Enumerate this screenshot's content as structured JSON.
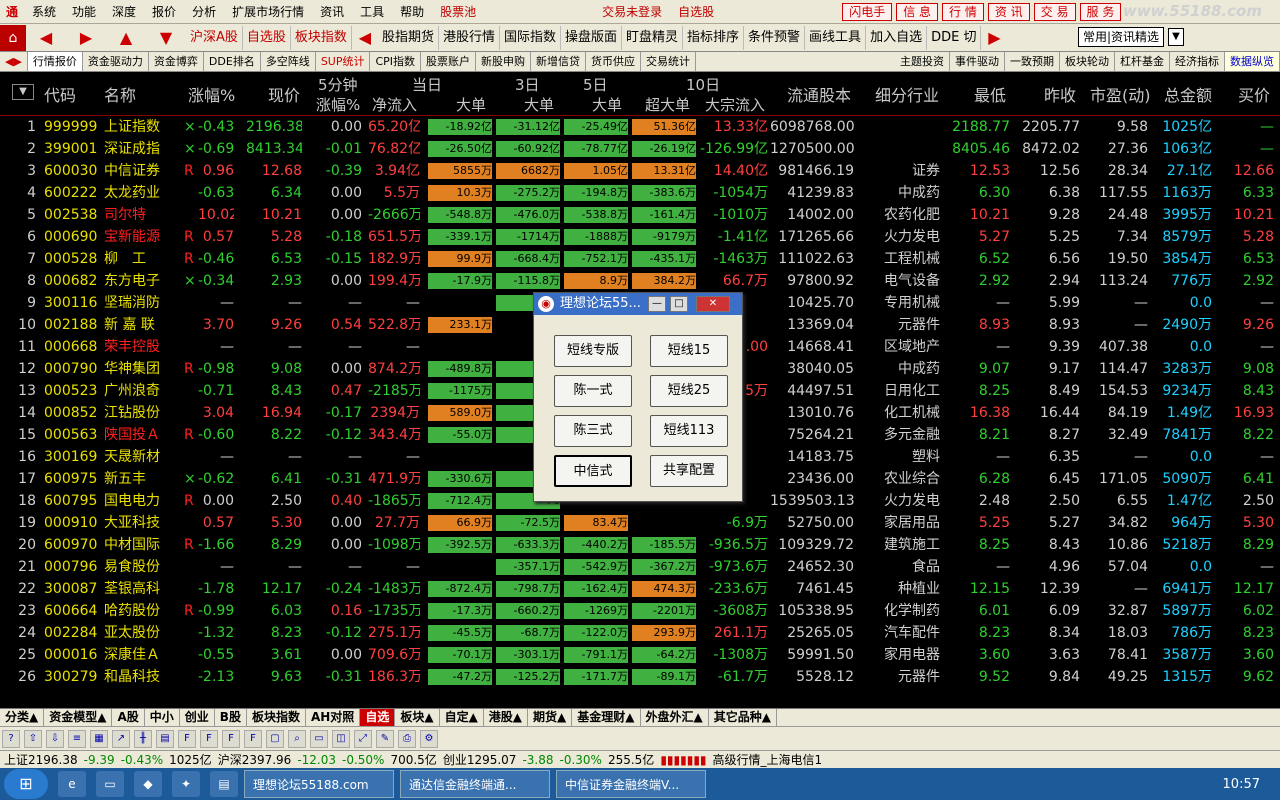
{
  "menu": {
    "items": [
      "系统",
      "功能",
      "深度",
      "报价",
      "分析",
      "扩展市场行情",
      "资讯",
      "工具",
      "帮助"
    ],
    "stockpool": "股票池",
    "login_status": "交易未登录",
    "favorites": "自选股",
    "flash": "闪电手",
    "right": [
      "信 息",
      "行 情",
      "资 讯",
      "交 易",
      "服 务"
    ],
    "watermark": "www.55188.com"
  },
  "toolbar": {
    "items": [
      "沪深A股",
      "自选股",
      "板块指数",
      "股指期货",
      "港股行情",
      "国际指数",
      "操盘版面",
      "盯盘精灵",
      "指标排序",
      "条件预警",
      "画线工具",
      "加入自选",
      "DDE 切"
    ],
    "dropdown": "常用|资讯精选"
  },
  "tabs": {
    "left": [
      "行情报价",
      "资金驱动力",
      "资金博弈",
      "DDE排名",
      "多空阵线",
      "SUP统计",
      "CPI指数",
      "股票账户",
      "新股申购",
      "新增信贷",
      "货币供应",
      "交易统计"
    ],
    "right": [
      "主题投资",
      "事件驱动",
      "一致预期",
      "板块轮动",
      "杠杆基金",
      "经济指标",
      "数据纵览"
    ]
  },
  "header": {
    "group5": "5分钟",
    "groupToday": "当日",
    "group3": "3日",
    "group5d": "5日",
    "group10": "10日",
    "cols": [
      "代码",
      "名称",
      "涨幅%",
      "现价",
      "涨幅%",
      "净流入",
      "大单",
      "大单",
      "大单",
      "超大单",
      "大宗流入",
      "流通股本",
      "细分行业",
      "最低",
      "昨收",
      "市盈(动)",
      "总金额",
      "买价"
    ]
  },
  "rows": [
    {
      "n": "1",
      "code": "999999",
      "name": "上证指数",
      "flag": "×",
      "chg": "-0.43",
      "price": "2196.38",
      "m5": "0.00",
      "net": "65.20亿",
      "b1": "-18.92亿",
      "b3": "-31.12亿",
      "b5": "-25.49亿",
      "b10": "51.36亿",
      "bulk": "13.33亿",
      "cap": "6098768.00",
      "ind": "",
      "low": "2188.77",
      "prev": "2205.77",
      "pe": "9.58",
      "amt": "1025亿",
      "bid": "—"
    },
    {
      "n": "2",
      "code": "399001",
      "name": "深证成指",
      "flag": "×",
      "chg": "-0.69",
      "price": "8413.34",
      "m5": "-0.01",
      "net": "76.82亿",
      "b1": "-26.50亿",
      "b3": "-60.92亿",
      "b5": "-78.77亿",
      "b10": "-26.19亿",
      "bulk": "-126.99亿",
      "cap": "1270500.00",
      "ind": "",
      "low": "8405.46",
      "prev": "8472.02",
      "pe": "27.36",
      "amt": "1063亿",
      "bid": "—"
    },
    {
      "n": "3",
      "code": "600030",
      "name": "中信证券",
      "flag": "R",
      "chg": "0.96",
      "price": "12.68",
      "m5": "-0.39",
      "net": "3.94亿",
      "b1": "5855万",
      "b3": "6682万",
      "b5": "1.05亿",
      "b10": "13.31亿",
      "bulk": "14.40亿",
      "cap": "981466.19",
      "ind": "证券",
      "low": "12.53",
      "prev": "12.56",
      "pe": "28.34",
      "amt": "27.1亿",
      "bid": "12.66"
    },
    {
      "n": "4",
      "code": "600222",
      "name": "太龙药业",
      "flag": "",
      "chg": "-0.63",
      "price": "6.34",
      "m5": "0.00",
      "net": "5.5万",
      "b1": "10.3万",
      "b3": "-275.2万",
      "b5": "-194.8万",
      "b10": "-383.6万",
      "bulk": "-1054万",
      "cap": "41239.83",
      "ind": "中成药",
      "low": "6.30",
      "prev": "6.38",
      "pe": "117.55",
      "amt": "1163万",
      "bid": "6.33"
    },
    {
      "n": "5",
      "code": "002538",
      "name": "司尔特",
      "flag": "",
      "chg": "10.02",
      "price": "10.21",
      "m5": "0.00",
      "net": "-2666万",
      "b1": "-548.8万",
      "b3": "-476.0万",
      "b5": "-538.8万",
      "b10": "-161.4万",
      "bulk": "-1010万",
      "cap": "14002.00",
      "ind": "农药化肥",
      "low": "10.21",
      "prev": "9.28",
      "pe": "24.48",
      "amt": "3995万",
      "bid": "10.21"
    },
    {
      "n": "6",
      "code": "000690",
      "name": "宝新能源",
      "flag": "R",
      "chg": "0.57",
      "price": "5.28",
      "m5": "-0.18",
      "net": "651.5万",
      "b1": "-339.1万",
      "b3": "-1714万",
      "b5": "-1888万",
      "b10": "-9179万",
      "bulk": "-1.41亿",
      "cap": "171265.66",
      "ind": "火力发电",
      "low": "5.27",
      "prev": "5.25",
      "pe": "7.34",
      "amt": "8579万",
      "bid": "5.28"
    },
    {
      "n": "7",
      "code": "000528",
      "name": "柳　工",
      "flag": "R",
      "chg": "-0.46",
      "price": "6.53",
      "m5": "-0.15",
      "net": "182.9万",
      "b1": "99.9万",
      "b3": "-668.4万",
      "b5": "-752.1万",
      "b10": "-435.1万",
      "bulk": "-1463万",
      "cap": "111022.63",
      "ind": "工程机械",
      "low": "6.52",
      "prev": "6.56",
      "pe": "19.50",
      "amt": "3854万",
      "bid": "6.53"
    },
    {
      "n": "8",
      "code": "000682",
      "name": "东方电子",
      "flag": "×",
      "chg": "-0.34",
      "price": "2.93",
      "m5": "0.00",
      "net": "199.4万",
      "b1": "-17.9万",
      "b3": "-115.8万",
      "b5": "8.9万",
      "b10": "384.2万",
      "bulk": "66.7万",
      "cap": "97800.92",
      "ind": "电气设备",
      "low": "2.92",
      "prev": "2.94",
      "pe": "113.24",
      "amt": "776万",
      "bid": "2.92"
    },
    {
      "n": "9",
      "code": "300116",
      "name": "坚瑞消防",
      "flag": "",
      "chg": "—",
      "price": "—",
      "m5": "—",
      "net": "—",
      "b1": "",
      "b3": "-22",
      "b5": "",
      "b10": "",
      "bulk": "",
      "cap": "10425.70",
      "ind": "专用机械",
      "low": "—",
      "prev": "5.99",
      "pe": "—",
      "amt": "0.0",
      "bid": "—"
    },
    {
      "n": "10",
      "code": "002188",
      "name": "新 嘉 联",
      "flag": "",
      "chg": "3.70",
      "price": "9.26",
      "m5": "0.54",
      "net": "522.8万",
      "b1": "233.1万",
      "b3": "",
      "b5": "",
      "b10": "",
      "bulk": "",
      "cap": "13369.04",
      "ind": "元器件",
      "low": "8.93",
      "prev": "8.93",
      "pe": "—",
      "amt": "2490万",
      "bid": "9.26"
    },
    {
      "n": "11",
      "code": "000668",
      "name": "荣丰控股",
      "flag": "",
      "chg": "—",
      "price": "—",
      "m5": "—",
      "net": "—",
      "b1": "",
      "b3": "",
      "b5": "",
      "b10": "",
      "bulk": ".00",
      "cap": "14668.41",
      "ind": "区域地产",
      "low": "—",
      "prev": "9.39",
      "pe": "407.38",
      "amt": "0.0",
      "bid": "—"
    },
    {
      "n": "12",
      "code": "000790",
      "name": "华神集团",
      "flag": "R",
      "chg": "-0.98",
      "price": "9.08",
      "m5": "0.00",
      "net": "874.2万",
      "b1": "-489.8万",
      "b3": "-1",
      "b5": "",
      "b10": "",
      "bulk": "",
      "cap": "38040.05",
      "ind": "中成药",
      "low": "9.07",
      "prev": "9.17",
      "pe": "114.47",
      "amt": "3283万",
      "bid": "9.08"
    },
    {
      "n": "13",
      "code": "000523",
      "name": "广州浪奇",
      "flag": "",
      "chg": "-0.71",
      "price": "8.43",
      "m5": "0.47",
      "net": "-2185万",
      "b1": "-1175万",
      "b3": "-1",
      "b5": "",
      "b10": "",
      "bulk": "5万",
      "cap": "44497.51",
      "ind": "日用化工",
      "low": "8.25",
      "prev": "8.49",
      "pe": "154.53",
      "amt": "9234万",
      "bid": "8.43"
    },
    {
      "n": "14",
      "code": "000852",
      "name": "江钻股份",
      "flag": "",
      "chg": "3.04",
      "price": "16.94",
      "m5": "-0.17",
      "net": "2394万",
      "b1": "589.0万",
      "b3": "-5",
      "b5": "",
      "b10": "",
      "bulk": "",
      "cap": "13010.76",
      "ind": "化工机械",
      "low": "16.38",
      "prev": "16.44",
      "pe": "84.19",
      "amt": "1.49亿",
      "bid": "16.93"
    },
    {
      "n": "15",
      "code": "000563",
      "name": "陕国投Ａ",
      "flag": "R",
      "chg": "-0.60",
      "price": "8.22",
      "m5": "-0.12",
      "net": "343.4万",
      "b1": "-55.0万",
      "b3": "-5",
      "b5": "",
      "b10": "",
      "bulk": "",
      "cap": "75264.21",
      "ind": "多元金融",
      "low": "8.21",
      "prev": "8.27",
      "pe": "32.49",
      "amt": "7841万",
      "bid": "8.22"
    },
    {
      "n": "16",
      "code": "300169",
      "name": "天晟新材",
      "flag": "",
      "chg": "—",
      "price": "—",
      "m5": "—",
      "net": "—",
      "b1": "",
      "b3": "",
      "b5": "",
      "b10": "",
      "bulk": "",
      "cap": "14183.75",
      "ind": "塑料",
      "low": "—",
      "prev": "6.35",
      "pe": "—",
      "amt": "0.0",
      "bid": "—"
    },
    {
      "n": "17",
      "code": "600975",
      "name": "新五丰",
      "flag": "×",
      "chg": "-0.62",
      "price": "6.41",
      "m5": "-0.31",
      "net": "471.9万",
      "b1": "-330.6万",
      "b3": "-14",
      "b5": "",
      "b10": "",
      "bulk": "",
      "cap": "23436.00",
      "ind": "农业综合",
      "low": "6.28",
      "prev": "6.45",
      "pe": "171.05",
      "amt": "5090万",
      "bid": "6.41"
    },
    {
      "n": "18",
      "code": "600795",
      "name": "国电电力",
      "flag": "R",
      "chg": "0.00",
      "price": "2.50",
      "m5": "0.40",
      "net": "-1865万",
      "b1": "-712.4万",
      "b3": "-76",
      "b5": "",
      "b10": "",
      "bulk": "",
      "cap": "1539503.13",
      "ind": "火力发电",
      "low": "2.48",
      "prev": "2.50",
      "pe": "6.55",
      "amt": "1.47亿",
      "bid": "2.50"
    },
    {
      "n": "19",
      "code": "000910",
      "name": "大亚科技",
      "flag": "",
      "chg": "0.57",
      "price": "5.30",
      "m5": "0.00",
      "net": "27.7万",
      "b1": "66.9万",
      "b3": "-72.5万",
      "b5": "83.4万",
      "b10": "",
      "bulk": "-6.9万",
      "cap": "52750.00",
      "ind": "家居用品",
      "low": "5.25",
      "prev": "5.27",
      "pe": "34.82",
      "amt": "964万",
      "bid": "5.30"
    },
    {
      "n": "20",
      "code": "600970",
      "name": "中材国际",
      "flag": "R",
      "chg": "-1.66",
      "price": "8.29",
      "m5": "0.00",
      "net": "-1098万",
      "b1": "-392.5万",
      "b3": "-633.3万",
      "b5": "-440.2万",
      "b10": "-185.5万",
      "bulk": "-936.5万",
      "cap": "109329.72",
      "ind": "建筑施工",
      "low": "8.25",
      "prev": "8.43",
      "pe": "10.86",
      "amt": "5218万",
      "bid": "8.29"
    },
    {
      "n": "21",
      "code": "000796",
      "name": "易食股份",
      "flag": "",
      "chg": "—",
      "price": "—",
      "m5": "—",
      "net": "—",
      "b1": "",
      "b3": "-357.1万",
      "b5": "-542.9万",
      "b10": "-367.2万",
      "bulk": "-973.6万",
      "cap": "24652.30",
      "ind": "食品",
      "low": "—",
      "prev": "4.96",
      "pe": "57.04",
      "amt": "0.0",
      "bid": "—"
    },
    {
      "n": "22",
      "code": "300087",
      "name": "荃银高科",
      "flag": "",
      "chg": "-1.78",
      "price": "12.17",
      "m5": "-0.24",
      "net": "-1483万",
      "b1": "-872.4万",
      "b3": "-798.7万",
      "b5": "-162.4万",
      "b10": "474.3万",
      "bulk": "-233.6万",
      "cap": "7461.45",
      "ind": "种植业",
      "low": "12.15",
      "prev": "12.39",
      "pe": "—",
      "amt": "6941万",
      "bid": "12.17"
    },
    {
      "n": "23",
      "code": "600664",
      "name": "哈药股份",
      "flag": "R",
      "chg": "-0.99",
      "price": "6.03",
      "m5": "0.16",
      "net": "-1735万",
      "b1": "-17.3万",
      "b3": "-660.2万",
      "b5": "-1269万",
      "b10": "-2201万",
      "bulk": "-3608万",
      "cap": "105338.95",
      "ind": "化学制药",
      "low": "6.01",
      "prev": "6.09",
      "pe": "32.87",
      "amt": "5897万",
      "bid": "6.02"
    },
    {
      "n": "24",
      "code": "002284",
      "name": "亚太股份",
      "flag": "",
      "chg": "-1.32",
      "price": "8.23",
      "m5": "-0.12",
      "net": "275.1万",
      "b1": "-45.5万",
      "b3": "-68.7万",
      "b5": "-122.0万",
      "b10": "293.9万",
      "bulk": "261.1万",
      "cap": "25265.05",
      "ind": "汽车配件",
      "low": "8.23",
      "prev": "8.34",
      "pe": "18.03",
      "amt": "786万",
      "bid": "8.23"
    },
    {
      "n": "25",
      "code": "000016",
      "name": "深康佳Ａ",
      "flag": "",
      "chg": "-0.55",
      "price": "3.61",
      "m5": "0.00",
      "net": "709.6万",
      "b1": "-70.1万",
      "b3": "-303.1万",
      "b5": "-791.1万",
      "b10": "-64.2万",
      "bulk": "-1308万",
      "cap": "59991.50",
      "ind": "家用电器",
      "low": "3.60",
      "prev": "3.63",
      "pe": "78.41",
      "amt": "3587万",
      "bid": "3.60"
    },
    {
      "n": "26",
      "code": "300279",
      "name": "和晶科技",
      "flag": "",
      "chg": "-2.13",
      "price": "9.63",
      "m5": "-0.31",
      "net": "186.3万",
      "b1": "-47.2万",
      "b3": "-125.2万",
      "b5": "-171.7万",
      "b10": "-89.1万",
      "bulk": "-61.7万",
      "cap": "5528.12",
      "ind": "元器件",
      "low": "9.52",
      "prev": "9.84",
      "pe": "49.25",
      "amt": "1315万",
      "bid": "9.62"
    }
  ],
  "dialog": {
    "title": "理想论坛55...",
    "buttons": [
      "短线专版",
      "短线15",
      "陈一式",
      "短线25",
      "陈三式",
      "短线113",
      "中信式",
      "共享配置"
    ]
  },
  "bottomtabs": [
    "分类▲",
    "资金模型▲",
    "A股",
    "中小",
    "创业",
    "B股",
    "板块指数",
    "AH对照",
    "自选",
    "板块▲",
    "自定▲",
    "港股▲",
    "期货▲",
    "基金理财▲",
    "外盘外汇▲",
    "其它品种▲"
  ],
  "status": {
    "sh": "上证2196.38",
    "sh_chg": "-9.39",
    "sh_pct": "-0.43%",
    "sh_amt": "1025亿",
    "sz": "沪深2397.96",
    "sz_chg": "-12.03",
    "sz_pct": "-0.50%",
    "sz_amt": "700.5亿",
    "cy": "创业1295.07",
    "cy_chg": "-3.88",
    "cy_pct": "-0.30%",
    "cy_amt": "255.5亿",
    "feed": "高级行情_上海电信1"
  },
  "taskbar": {
    "tasks": [
      "理想论坛55188.com",
      "通达信金融终端通...",
      "中信证券金融终端V..."
    ],
    "clock": "10:57"
  }
}
